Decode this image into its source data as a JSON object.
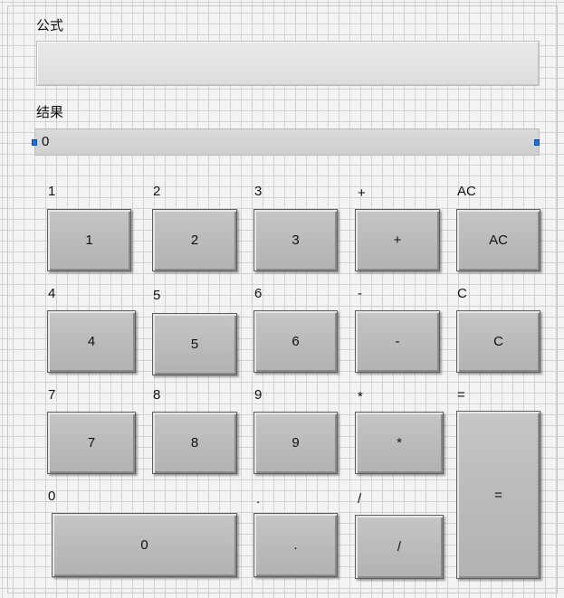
{
  "formula": {
    "label": "公式",
    "value": ""
  },
  "result": {
    "label": "结果",
    "value": "0"
  },
  "buttons": {
    "b1": {
      "caption": "1",
      "label": "1"
    },
    "b2": {
      "caption": "2",
      "label": "2"
    },
    "b3": {
      "caption": "3",
      "label": "3"
    },
    "add": {
      "caption": "+",
      "label": "+"
    },
    "ac": {
      "caption": "AC",
      "label": "AC"
    },
    "b4": {
      "caption": "4",
      "label": "4"
    },
    "b5": {
      "caption": "5",
      "label": "5"
    },
    "b6": {
      "caption": "6",
      "label": "6"
    },
    "sub": {
      "caption": "-",
      "label": "-"
    },
    "c": {
      "caption": "C",
      "label": "C"
    },
    "b7": {
      "caption": "7",
      "label": "7"
    },
    "b8": {
      "caption": "8",
      "label": "8"
    },
    "b9": {
      "caption": "9",
      "label": "9"
    },
    "mul": {
      "caption": "*",
      "label": "*"
    },
    "eq": {
      "caption": "=",
      "label": "="
    },
    "b0": {
      "caption": "0",
      "label": "0"
    },
    "dot": {
      "caption": ".",
      "label": "."
    },
    "div": {
      "caption": "/",
      "label": "/"
    }
  }
}
